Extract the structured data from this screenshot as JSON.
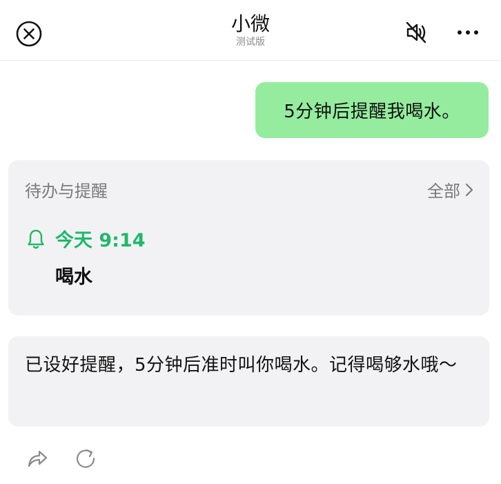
{
  "header": {
    "title": "小微",
    "subtitle": "测试版",
    "close_icon": "close-circle-icon",
    "mute_icon": "mute-off-icon",
    "more_icon": "more-icon"
  },
  "messages": {
    "user_text": "5分钟后提醒我喝水。",
    "reply_text": "已设好提醒，5分钟后准时叫你喝水。记得喝够水哦～"
  },
  "todo_card": {
    "title": "待办与提醒",
    "all_label": "全部",
    "reminder": {
      "time": "今天 9:14",
      "title": "喝水"
    }
  },
  "actions": {
    "share_icon": "share-icon",
    "refresh_icon": "refresh-icon"
  },
  "colors": {
    "user_bubble": "#95ec9e",
    "accent_green": "#1fb86a",
    "card_bg": "#f2f2f4"
  }
}
